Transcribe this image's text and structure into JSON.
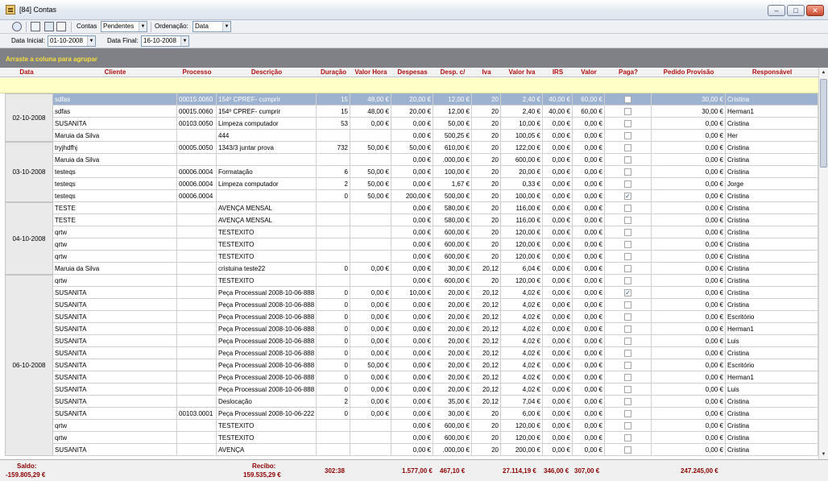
{
  "window": {
    "title": "[84] Contas"
  },
  "toolbar": {
    "contas_label": "Contas",
    "contas_value": "Pendentes",
    "ordenacao_label": "Ordenação:",
    "ordenacao_value": "Data",
    "data_inicial_label": "Data Inicial:",
    "data_inicial_value": "01-10-2008",
    "data_final_label": "Data Final:",
    "data_final_value": "16-10-2008"
  },
  "group_panel": {
    "text": "Arraste a coluna para agrupar"
  },
  "columns": [
    "Data",
    "Cliente",
    "Processo",
    "Descrição",
    "Duração",
    "Valor Hora",
    "Despesas",
    "Desp. c/",
    "Iva",
    "Valor Iva",
    "IRS",
    "Valor",
    "Paga?",
    "Pedido Provisão",
    "Responsável"
  ],
  "groups": [
    {
      "date": "02-10-2008",
      "rows": [
        {
          "cliente": "sdfas",
          "processo": "00015.0060",
          "descricao": "154º CPREF- cumprir",
          "duracao": "15",
          "valor_hora": "48,00 €",
          "despesas": "20,00 €",
          "desp": "12,00 €",
          "iva": "20",
          "valor_iva": "2,40 €",
          "irs": "40,00 €",
          "valor": "60,00 €",
          "paga": false,
          "pedido": "30,00 €",
          "responsavel": "Cristina",
          "selected": true
        },
        {
          "cliente": "sdfas",
          "processo": "00015.0060",
          "descricao": "154º CPREF- cumprir",
          "duracao": "15",
          "valor_hora": "48,00 €",
          "despesas": "20,00 €",
          "desp": "12,00 €",
          "iva": "20",
          "valor_iva": "2,40 €",
          "irs": "40,00 €",
          "valor": "60,00 €",
          "paga": false,
          "pedido": "30,00 €",
          "responsavel": "Herman1"
        },
        {
          "cliente": "SUSANITA",
          "processo": "00103.0050",
          "descricao": "Limpeza computador",
          "duracao": "53",
          "valor_hora": "0,00 €",
          "despesas": "0,00 €",
          "desp": "50,00 €",
          "iva": "20",
          "valor_iva": "10,00 €",
          "irs": "0,00 €",
          "valor": "0,00 €",
          "paga": false,
          "pedido": "0,00 €",
          "responsavel": "Cristina"
        },
        {
          "cliente": "Maruia da Silva",
          "processo": "",
          "descricao": "444",
          "duracao": "",
          "valor_hora": "",
          "despesas": "0,00 €",
          "desp": "500,25 €",
          "iva": "20",
          "valor_iva": "100,05 €",
          "irs": "0,00 €",
          "valor": "0,00 €",
          "paga": false,
          "pedido": "0,00 €",
          "responsavel": "Her"
        }
      ]
    },
    {
      "date": "03-10-2008",
      "rows": [
        {
          "cliente": "tryjhdfhj",
          "processo": "00005.0050",
          "descricao": "1343/3 juntar prova",
          "duracao": "732",
          "valor_hora": "50,00 €",
          "despesas": "50,00 €",
          "desp": "610,00 €",
          "iva": "20",
          "valor_iva": "122,00 €",
          "irs": "0,00 €",
          "valor": "0,00 €",
          "paga": false,
          "pedido": "0,00 €",
          "responsavel": "Cristina"
        },
        {
          "cliente": "Maruia da Silva",
          "processo": "",
          "descricao": "",
          "duracao": "",
          "valor_hora": "",
          "despesas": "0,00 €",
          "desp": ".000,00 €",
          "iva": "20",
          "valor_iva": "600,00 €",
          "irs": "0,00 €",
          "valor": "0,00 €",
          "paga": false,
          "pedido": "0,00 €",
          "responsavel": "Cristina"
        },
        {
          "cliente": "testeqs",
          "processo": "00006.0004",
          "descricao": "Formatação",
          "duracao": "6",
          "valor_hora": "50,00 €",
          "despesas": "0,00 €",
          "desp": "100,00 €",
          "iva": "20",
          "valor_iva": "20,00 €",
          "irs": "0,00 €",
          "valor": "0,00 €",
          "paga": false,
          "pedido": "0,00 €",
          "responsavel": "Cristina"
        },
        {
          "cliente": "testeqs",
          "processo": "00006.0004",
          "descricao": "Limpeza computador",
          "duracao": "2",
          "valor_hora": "50,00 €",
          "despesas": "0,00 €",
          "desp": "1,67 €",
          "iva": "20",
          "valor_iva": "0,33 €",
          "irs": "0,00 €",
          "valor": "0,00 €",
          "paga": false,
          "pedido": "0,00 €",
          "responsavel": "Jorge"
        },
        {
          "cliente": "testeqs",
          "processo": "00006.0004",
          "descricao": "",
          "duracao": "0",
          "valor_hora": "50,00 €",
          "despesas": "200,00 €",
          "desp": "500,00 €",
          "iva": "20",
          "valor_iva": "100,00 €",
          "irs": "0,00 €",
          "valor": "0,00 €",
          "paga": true,
          "pedido": "0,00 €",
          "responsavel": "Cristina"
        }
      ]
    },
    {
      "date": "04-10-2008",
      "rows": [
        {
          "cliente": "TESTE",
          "processo": "",
          "descricao": "AVENÇA MENSAL",
          "duracao": "",
          "valor_hora": "",
          "despesas": "0,00 €",
          "desp": "580,00 €",
          "iva": "20",
          "valor_iva": "116,00 €",
          "irs": "0,00 €",
          "valor": "0,00 €",
          "paga": false,
          "pedido": "0,00 €",
          "responsavel": "Cristina"
        },
        {
          "cliente": "TESTE",
          "processo": "",
          "descricao": "AVENÇA MENSAL",
          "duracao": "",
          "valor_hora": "",
          "despesas": "0,00 €",
          "desp": "580,00 €",
          "iva": "20",
          "valor_iva": "116,00 €",
          "irs": "0,00 €",
          "valor": "0,00 €",
          "paga": false,
          "pedido": "0,00 €",
          "responsavel": "Cristina"
        },
        {
          "cliente": "qrtw",
          "processo": "",
          "descricao": "TESTEXITO",
          "duracao": "",
          "valor_hora": "",
          "despesas": "0,00 €",
          "desp": "600,00 €",
          "iva": "20",
          "valor_iva": "120,00 €",
          "irs": "0,00 €",
          "valor": "0,00 €",
          "paga": false,
          "pedido": "0,00 €",
          "responsavel": "Cristina"
        },
        {
          "cliente": "qrtw",
          "processo": "",
          "descricao": "TESTEXITO",
          "duracao": "",
          "valor_hora": "",
          "despesas": "0,00 €",
          "desp": "600,00 €",
          "iva": "20",
          "valor_iva": "120,00 €",
          "irs": "0,00 €",
          "valor": "0,00 €",
          "paga": false,
          "pedido": "0,00 €",
          "responsavel": "Cristina"
        },
        {
          "cliente": "qrtw",
          "processo": "",
          "descricao": "TESTEXITO",
          "duracao": "",
          "valor_hora": "",
          "despesas": "0,00 €",
          "desp": "600,00 €",
          "iva": "20",
          "valor_iva": "120,00 €",
          "irs": "0,00 €",
          "valor": "0,00 €",
          "paga": false,
          "pedido": "0,00 €",
          "responsavel": "Cristina"
        },
        {
          "cliente": "Maruia da Silva",
          "processo": "",
          "descricao": "cristuina teste22",
          "duracao": "0",
          "valor_hora": "0,00 €",
          "despesas": "0,00 €",
          "desp": "30,00 €",
          "iva": "20,12",
          "valor_iva": "6,04 €",
          "irs": "0,00 €",
          "valor": "0,00 €",
          "paga": false,
          "pedido": "0,00 €",
          "responsavel": "Cristina"
        }
      ]
    },
    {
      "date": "06-10-2008",
      "rows": [
        {
          "cliente": "qrtw",
          "processo": "",
          "descricao": "TESTEXITO",
          "duracao": "",
          "valor_hora": "",
          "despesas": "0,00 €",
          "desp": "600,00 €",
          "iva": "20",
          "valor_iva": "120,00 €",
          "irs": "0,00 €",
          "valor": "0,00 €",
          "paga": false,
          "pedido": "0,00 €",
          "responsavel": "Cristina"
        },
        {
          "cliente": "SUSANITA",
          "processo": "",
          "descricao": "Peça Processual 2008-10-06-888",
          "duracao": "0",
          "valor_hora": "0,00 €",
          "despesas": "10,00 €",
          "desp": "20,00 €",
          "iva": "20,12",
          "valor_iva": "4,02 €",
          "irs": "0,00 €",
          "valor": "0,00 €",
          "paga": true,
          "pedido": "0,00 €",
          "responsavel": "Cristina"
        },
        {
          "cliente": "SUSANITA",
          "processo": "",
          "descricao": "Peça Processual 2008-10-06-888",
          "duracao": "0",
          "valor_hora": "0,00 €",
          "despesas": "0,00 €",
          "desp": "20,00 €",
          "iva": "20,12",
          "valor_iva": "4,02 €",
          "irs": "0,00 €",
          "valor": "0,00 €",
          "paga": false,
          "pedido": "0,00 €",
          "responsavel": "Cristina"
        },
        {
          "cliente": "SUSANITA",
          "processo": "",
          "descricao": "Peça Processual 2008-10-06-888",
          "duracao": "0",
          "valor_hora": "0,00 €",
          "despesas": "0,00 €",
          "desp": "20,00 €",
          "iva": "20,12",
          "valor_iva": "4,02 €",
          "irs": "0,00 €",
          "valor": "0,00 €",
          "paga": false,
          "pedido": "0,00 €",
          "responsavel": "Escritório"
        },
        {
          "cliente": "SUSANITA",
          "processo": "",
          "descricao": "Peça Processual 2008-10-06-888",
          "duracao": "0",
          "valor_hora": "0,00 €",
          "despesas": "0,00 €",
          "desp": "20,00 €",
          "iva": "20,12",
          "valor_iva": "4,02 €",
          "irs": "0,00 €",
          "valor": "0,00 €",
          "paga": false,
          "pedido": "0,00 €",
          "responsavel": "Herman1"
        },
        {
          "cliente": "SUSANITA",
          "processo": "",
          "descricao": "Peça Processual 2008-10-06-888",
          "duracao": "0",
          "valor_hora": "0,00 €",
          "despesas": "0,00 €",
          "desp": "20,00 €",
          "iva": "20,12",
          "valor_iva": "4,02 €",
          "irs": "0,00 €",
          "valor": "0,00 €",
          "paga": false,
          "pedido": "0,00 €",
          "responsavel": "Luis"
        },
        {
          "cliente": "SUSANITA",
          "processo": "",
          "descricao": "Peça Processual 2008-10-06-888",
          "duracao": "0",
          "valor_hora": "0,00 €",
          "despesas": "0,00 €",
          "desp": "20,00 €",
          "iva": "20,12",
          "valor_iva": "4,02 €",
          "irs": "0,00 €",
          "valor": "0,00 €",
          "paga": false,
          "pedido": "0,00 €",
          "responsavel": "Cristina"
        },
        {
          "cliente": "SUSANITA",
          "processo": "",
          "descricao": "Peça Processual 2008-10-06-888",
          "duracao": "0",
          "valor_hora": "50,00 €",
          "despesas": "0,00 €",
          "desp": "20,00 €",
          "iva": "20,12",
          "valor_iva": "4,02 €",
          "irs": "0,00 €",
          "valor": "0,00 €",
          "paga": false,
          "pedido": "0,00 €",
          "responsavel": "Escritório"
        },
        {
          "cliente": "SUSANITA",
          "processo": "",
          "descricao": "Peça Processual 2008-10-06-888",
          "duracao": "0",
          "valor_hora": "0,00 €",
          "despesas": "0,00 €",
          "desp": "20,00 €",
          "iva": "20,12",
          "valor_iva": "4,02 €",
          "irs": "0,00 €",
          "valor": "0,00 €",
          "paga": false,
          "pedido": "0,00 €",
          "responsavel": "Herman1"
        },
        {
          "cliente": "SUSANITA",
          "processo": "",
          "descricao": "Peça Processual 2008-10-06-888",
          "duracao": "0",
          "valor_hora": "0,00 €",
          "despesas": "0,00 €",
          "desp": "20,00 €",
          "iva": "20,12",
          "valor_iva": "4,02 €",
          "irs": "0,00 €",
          "valor": "0,00 €",
          "paga": false,
          "pedido": "0,00 €",
          "responsavel": "Luis"
        },
        {
          "cliente": "SUSANITA",
          "processo": "",
          "descricao": "Deslocação",
          "duracao": "2",
          "valor_hora": "0,00 €",
          "despesas": "0,00 €",
          "desp": "35,00 €",
          "iva": "20,12",
          "valor_iva": "7,04 €",
          "irs": "0,00 €",
          "valor": "0,00 €",
          "paga": false,
          "pedido": "0,00 €",
          "responsavel": "Cristina"
        },
        {
          "cliente": "SUSANITA",
          "processo": "00103.0001",
          "descricao": "Peça Processual 2008-10-06-222",
          "duracao": "0",
          "valor_hora": "0,00 €",
          "despesas": "0,00 €",
          "desp": "30,00 €",
          "iva": "20",
          "valor_iva": "6,00 €",
          "irs": "0,00 €",
          "valor": "0,00 €",
          "paga": false,
          "pedido": "0,00 €",
          "responsavel": "Cristina"
        },
        {
          "cliente": "qrtw",
          "processo": "",
          "descricao": "TESTEXITO",
          "duracao": "",
          "valor_hora": "",
          "despesas": "0,00 €",
          "desp": "600,00 €",
          "iva": "20",
          "valor_iva": "120,00 €",
          "irs": "0,00 €",
          "valor": "0,00 €",
          "paga": false,
          "pedido": "0,00 €",
          "responsavel": "Cristina"
        },
        {
          "cliente": "qrtw",
          "processo": "",
          "descricao": "TESTEXITO",
          "duracao": "",
          "valor_hora": "",
          "despesas": "0,00 €",
          "desp": "600,00 €",
          "iva": "20",
          "valor_iva": "120,00 €",
          "irs": "0,00 €",
          "valor": "0,00 €",
          "paga": false,
          "pedido": "0,00 €",
          "responsavel": "Cristina"
        },
        {
          "cliente": "SUSANITA",
          "processo": "",
          "descricao": "AVENÇA",
          "duracao": "",
          "valor_hora": "",
          "despesas": "0,00 €",
          "desp": ".000,00 €",
          "iva": "20",
          "valor_iva": "200,00 €",
          "irs": "0,00 €",
          "valor": "0,00 €",
          "paga": false,
          "pedido": "0,00 €",
          "responsavel": "Cristina"
        }
      ]
    }
  ],
  "footer": {
    "saldo_label": "Saldo:",
    "saldo_value": "-159.805,29 €",
    "recibo_label": "Recibo:",
    "recibo_value": "159.535,29 €",
    "duracao_total": "302:38",
    "despesas_total": "1.577,00 €",
    "desp_total": "467,10 €",
    "valor_iva_total": "27.114,19 €",
    "irs_total": "346,00 €",
    "valor_total": "307,00 €",
    "pedido_total": "247.245,00 €"
  }
}
